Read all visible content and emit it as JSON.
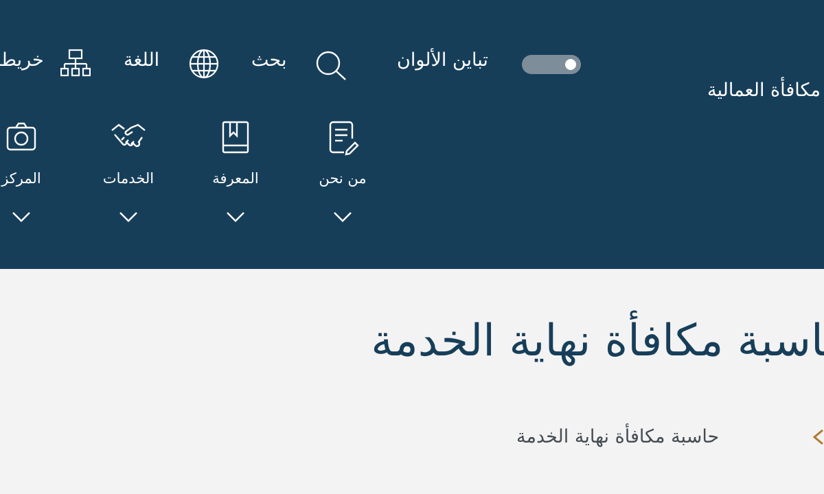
{
  "header": {
    "org_name": "مكافأة العمالية",
    "utility": {
      "site_map_label": "خريطة",
      "language_label": "اللغة",
      "search_label": "بحث",
      "contrast_label": "تباين الألوان",
      "contrast_enabled": true
    },
    "nav": [
      {
        "label": "من نحن",
        "icon": "edit-document-icon"
      },
      {
        "label": "المعرفة",
        "icon": "book-icon"
      },
      {
        "label": "الخدمات",
        "icon": "handshake-icon"
      },
      {
        "label": "المركز",
        "icon": "media-center-icon"
      }
    ]
  },
  "main": {
    "page_title": "حاسبة مكافأة نهاية الخدمة",
    "breadcrumb": {
      "current": "حاسبة مكافأة نهاية الخدمة"
    }
  },
  "colors": {
    "header_bg": "#173e59",
    "page_bg": "#f3f3f3",
    "title": "#173e59",
    "breadcrumb_chevron": "#b07a32"
  }
}
